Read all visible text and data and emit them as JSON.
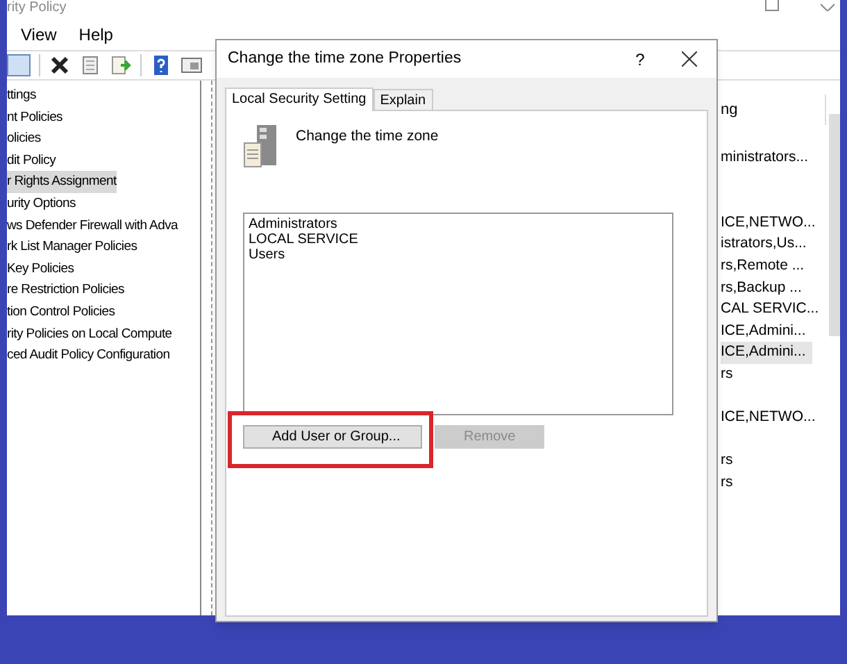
{
  "window": {
    "title": "rity Policy"
  },
  "menu": [
    "View",
    "Help"
  ],
  "tree": [
    {
      "label": "ttings",
      "selected": false
    },
    {
      "label": "nt Policies",
      "selected": false
    },
    {
      "label": "olicies",
      "selected": false
    },
    {
      "label": "dit Policy",
      "selected": false
    },
    {
      "label": "r Rights Assignment",
      "selected": true
    },
    {
      "label": "urity Options",
      "selected": false
    },
    {
      "label": "ws Defender Firewall with Adva",
      "selected": false
    },
    {
      "label": "rk List Manager Policies",
      "selected": false
    },
    {
      "label": "Key Policies",
      "selected": false
    },
    {
      "label": "re Restriction Policies",
      "selected": false
    },
    {
      "label": "tion Control Policies",
      "selected": false
    },
    {
      "label": "rity Policies on Local Compute",
      "selected": false
    },
    {
      "label": "ced Audit Policy Configuration",
      "selected": false
    }
  ],
  "list": {
    "column": "ng",
    "rows": [
      {
        "kind": "text",
        "text": "ministrators...",
        "selected": false
      },
      {
        "kind": "empty"
      },
      {
        "kind": "empty"
      },
      {
        "kind": "text",
        "text": "ICE,NETWO...",
        "selected": false
      },
      {
        "kind": "text",
        "text": "istrators,Us...",
        "selected": false
      },
      {
        "kind": "text",
        "text": "rs,Remote ...",
        "selected": false
      },
      {
        "kind": "text",
        "text": "rs,Backup ...",
        "selected": false
      },
      {
        "kind": "text",
        "text": "CAL SERVIC...",
        "selected": false
      },
      {
        "kind": "text",
        "text": "ICE,Admini...",
        "selected": false
      },
      {
        "kind": "text",
        "text": "ICE,Admini...",
        "selected": true
      },
      {
        "kind": "text",
        "text": "rs",
        "selected": false
      },
      {
        "kind": "empty"
      },
      {
        "kind": "text",
        "text": "ICE,NETWO...",
        "selected": false
      },
      {
        "kind": "empty"
      },
      {
        "kind": "text",
        "text": "rs",
        "selected": false
      },
      {
        "kind": "text",
        "text": "rs",
        "selected": false
      }
    ]
  },
  "dialog": {
    "title": "Change the time zone Properties",
    "help": "?",
    "tabs": [
      {
        "label": "Local Security Setting",
        "selected": true
      },
      {
        "label": "Explain",
        "selected": false
      }
    ],
    "policy": "Change the time zone",
    "members": [
      "Administrators",
      "LOCAL SERVICE",
      "Users"
    ],
    "buttons": [
      {
        "label": "Add User or Group...",
        "disabled": false,
        "highlighted": true
      },
      {
        "label": "Remove",
        "disabled": true,
        "highlighted": false
      }
    ]
  }
}
